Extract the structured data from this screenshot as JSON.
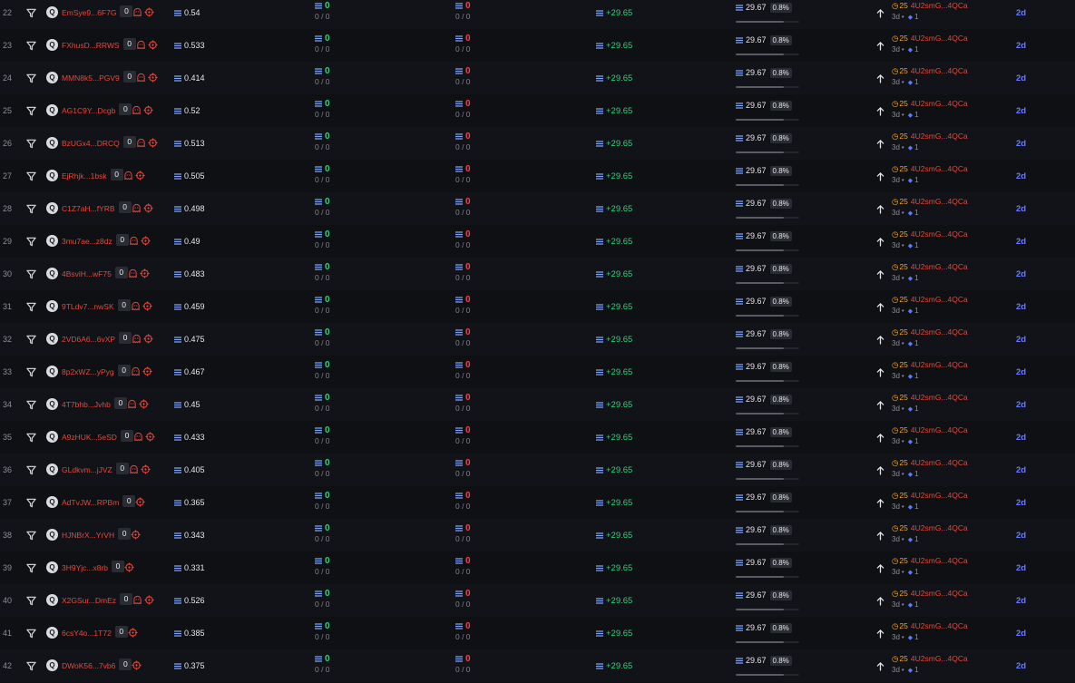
{
  "colors": {
    "background": "#0f1014",
    "address": "#e5483b",
    "positive": "#2bd67b",
    "negative": "#f0424d",
    "holder_count": "#f5a623",
    "age": "#6c7cff"
  },
  "icons": {
    "filter": "filter-icon",
    "avatar": "avatar-icon",
    "ghost": "ghost-icon",
    "target": "target-icon",
    "lines": "lines-icon",
    "arrow": "arrow-up-icon",
    "clock": "clock-icon"
  },
  "rows": [
    {
      "rank": "22",
      "avatar": "Q",
      "address": "EmSye9...6F7G",
      "badge": "0",
      "ghost": true,
      "score": "0.54",
      "buy": "0",
      "buy_sub": "0 / 0",
      "sell": "0",
      "sell_sub": "0 / 0",
      "pnl": "+29.65",
      "price": "29.67",
      "pct": "0.8%",
      "bar_fill": 0.75,
      "holder_count": "25",
      "holder_addr": "4U2smG...4QCa",
      "holder_age": "3d",
      "holder_num": "1",
      "age": "2d"
    },
    {
      "rank": "23",
      "avatar": "Q",
      "address": "FXhusD...RRWS",
      "badge": "0",
      "ghost": true,
      "score": "0.533",
      "buy": "0",
      "buy_sub": "0 / 0",
      "sell": "0",
      "sell_sub": "0 / 0",
      "pnl": "+29.65",
      "price": "29.67",
      "pct": "0.8%",
      "bar_fill": 0.75,
      "holder_count": "25",
      "holder_addr": "4U2smG...4QCa",
      "holder_age": "3d",
      "holder_num": "1",
      "age": "2d"
    },
    {
      "rank": "24",
      "avatar": "Q",
      "address": "MMN8k5...PGV9",
      "badge": "0",
      "ghost": true,
      "score": "0.414",
      "buy": "0",
      "buy_sub": "0 / 0",
      "sell": "0",
      "sell_sub": "0 / 0",
      "pnl": "+29.65",
      "price": "29.67",
      "pct": "0.8%",
      "bar_fill": 0.75,
      "holder_count": "25",
      "holder_addr": "4U2smG...4QCa",
      "holder_age": "3d",
      "holder_num": "1",
      "age": "2d"
    },
    {
      "rank": "25",
      "avatar": "Q",
      "address": "AG1C9Y...Dcgb",
      "badge": "0",
      "ghost": true,
      "score": "0.52",
      "buy": "0",
      "buy_sub": "0 / 0",
      "sell": "0",
      "sell_sub": "0 / 0",
      "pnl": "+29.65",
      "price": "29.67",
      "pct": "0.8%",
      "bar_fill": 0.75,
      "holder_count": "25",
      "holder_addr": "4U2smG...4QCa",
      "holder_age": "3d",
      "holder_num": "1",
      "age": "2d"
    },
    {
      "rank": "26",
      "avatar": "Q",
      "address": "BzUGx4...DRCQ",
      "badge": "0",
      "ghost": true,
      "score": "0.513",
      "buy": "0",
      "buy_sub": "0 / 0",
      "sell": "0",
      "sell_sub": "0 / 0",
      "pnl": "+29.65",
      "price": "29.67",
      "pct": "0.8%",
      "bar_fill": 0.75,
      "holder_count": "25",
      "holder_addr": "4U2smG...4QCa",
      "holder_age": "3d",
      "holder_num": "1",
      "age": "2d"
    },
    {
      "rank": "27",
      "avatar": "Q",
      "address": "EjRhjk...1bsk",
      "badge": "0",
      "ghost": true,
      "score": "0.505",
      "buy": "0",
      "buy_sub": "0 / 0",
      "sell": "0",
      "sell_sub": "0 / 0",
      "pnl": "+29.65",
      "price": "29.67",
      "pct": "0.8%",
      "bar_fill": 0.75,
      "holder_count": "25",
      "holder_addr": "4U2smG...4QCa",
      "holder_age": "3d",
      "holder_num": "1",
      "age": "2d"
    },
    {
      "rank": "28",
      "avatar": "Q",
      "address": "C1Z7aH...fYRB",
      "badge": "0",
      "ghost": true,
      "score": "0.498",
      "buy": "0",
      "buy_sub": "0 / 0",
      "sell": "0",
      "sell_sub": "0 / 0",
      "pnl": "+29.65",
      "price": "29.67",
      "pct": "0.8%",
      "bar_fill": 0.75,
      "holder_count": "25",
      "holder_addr": "4U2smG...4QCa",
      "holder_age": "3d",
      "holder_num": "1",
      "age": "2d"
    },
    {
      "rank": "29",
      "avatar": "Q",
      "address": "3mu7ae...z8dz",
      "badge": "0",
      "ghost": true,
      "score": "0.49",
      "buy": "0",
      "buy_sub": "0 / 0",
      "sell": "0",
      "sell_sub": "0 / 0",
      "pnl": "+29.65",
      "price": "29.67",
      "pct": "0.8%",
      "bar_fill": 0.75,
      "holder_count": "25",
      "holder_addr": "4U2smG...4QCa",
      "holder_age": "3d",
      "holder_num": "1",
      "age": "2d"
    },
    {
      "rank": "30",
      "avatar": "Q",
      "address": "4BsviH...wF75",
      "badge": "0",
      "ghost": true,
      "score": "0.483",
      "buy": "0",
      "buy_sub": "0 / 0",
      "sell": "0",
      "sell_sub": "0 / 0",
      "pnl": "+29.65",
      "price": "29.67",
      "pct": "0.8%",
      "bar_fill": 0.75,
      "holder_count": "25",
      "holder_addr": "4U2smG...4QCa",
      "holder_age": "3d",
      "holder_num": "1",
      "age": "2d"
    },
    {
      "rank": "31",
      "avatar": "Q",
      "address": "9TLdv7...nwSK",
      "badge": "0",
      "ghost": true,
      "score": "0.459",
      "buy": "0",
      "buy_sub": "0 / 0",
      "sell": "0",
      "sell_sub": "0 / 0",
      "pnl": "+29.65",
      "price": "29.67",
      "pct": "0.8%",
      "bar_fill": 0.75,
      "holder_count": "25",
      "holder_addr": "4U2smG...4QCa",
      "holder_age": "3d",
      "holder_num": "1",
      "age": "2d"
    },
    {
      "rank": "32",
      "avatar": "Q",
      "address": "2VD6A6...6vXP",
      "badge": "0",
      "ghost": true,
      "score": "0.475",
      "buy": "0",
      "buy_sub": "0 / 0",
      "sell": "0",
      "sell_sub": "0 / 0",
      "pnl": "+29.65",
      "price": "29.67",
      "pct": "0.8%",
      "bar_fill": 0.75,
      "holder_count": "25",
      "holder_addr": "4U2smG...4QCa",
      "holder_age": "3d",
      "holder_num": "1",
      "age": "2d"
    },
    {
      "rank": "33",
      "avatar": "Q",
      "address": "8p2xWZ...yPyg",
      "badge": "0",
      "ghost": true,
      "score": "0.467",
      "buy": "0",
      "buy_sub": "0 / 0",
      "sell": "0",
      "sell_sub": "0 / 0",
      "pnl": "+29.65",
      "price": "29.67",
      "pct": "0.8%",
      "bar_fill": 0.75,
      "holder_count": "25",
      "holder_addr": "4U2smG...4QCa",
      "holder_age": "3d",
      "holder_num": "1",
      "age": "2d"
    },
    {
      "rank": "34",
      "avatar": "Q",
      "address": "4T7bhb...Jvhb",
      "badge": "0",
      "ghost": true,
      "score": "0.45",
      "buy": "0",
      "buy_sub": "0 / 0",
      "sell": "0",
      "sell_sub": "0 / 0",
      "pnl": "+29.65",
      "price": "29.67",
      "pct": "0.8%",
      "bar_fill": 0.75,
      "holder_count": "25",
      "holder_addr": "4U2smG...4QCa",
      "holder_age": "3d",
      "holder_num": "1",
      "age": "2d"
    },
    {
      "rank": "35",
      "avatar": "Q",
      "address": "A9zHUK...5eSD",
      "badge": "0",
      "ghost": true,
      "score": "0.433",
      "buy": "0",
      "buy_sub": "0 / 0",
      "sell": "0",
      "sell_sub": "0 / 0",
      "pnl": "+29.65",
      "price": "29.67",
      "pct": "0.8%",
      "bar_fill": 0.75,
      "holder_count": "25",
      "holder_addr": "4U2smG...4QCa",
      "holder_age": "3d",
      "holder_num": "1",
      "age": "2d"
    },
    {
      "rank": "36",
      "avatar": "Q",
      "address": "GLdkvm...jJVZ",
      "badge": "0",
      "ghost": true,
      "score": "0.405",
      "buy": "0",
      "buy_sub": "0 / 0",
      "sell": "0",
      "sell_sub": "0 / 0",
      "pnl": "+29.65",
      "price": "29.67",
      "pct": "0.8%",
      "bar_fill": 0.75,
      "holder_count": "25",
      "holder_addr": "4U2smG...4QCa",
      "holder_age": "3d",
      "holder_num": "1",
      "age": "2d"
    },
    {
      "rank": "37",
      "avatar": "Q",
      "address": "AdTvJW...RPBm",
      "badge": "0",
      "ghost": false,
      "score": "0.365",
      "buy": "0",
      "buy_sub": "0 / 0",
      "sell": "0",
      "sell_sub": "0 / 0",
      "pnl": "+29.65",
      "price": "29.67",
      "pct": "0.8%",
      "bar_fill": 0.75,
      "holder_count": "25",
      "holder_addr": "4U2smG...4QCa",
      "holder_age": "3d",
      "holder_num": "1",
      "age": "2d"
    },
    {
      "rank": "38",
      "avatar": "Q",
      "address": "HJNBrX...YrVH",
      "badge": "0",
      "ghost": false,
      "score": "0.343",
      "buy": "0",
      "buy_sub": "0 / 0",
      "sell": "0",
      "sell_sub": "0 / 0",
      "pnl": "+29.65",
      "price": "29.67",
      "pct": "0.8%",
      "bar_fill": 0.75,
      "holder_count": "25",
      "holder_addr": "4U2smG...4QCa",
      "holder_age": "3d",
      "holder_num": "1",
      "age": "2d"
    },
    {
      "rank": "39",
      "avatar": "Q",
      "address": "3H9Yjc...x8rb",
      "badge": "0",
      "ghost": false,
      "score": "0.331",
      "buy": "0",
      "buy_sub": "0 / 0",
      "sell": "0",
      "sell_sub": "0 / 0",
      "pnl": "+29.65",
      "price": "29.67",
      "pct": "0.8%",
      "bar_fill": 0.75,
      "holder_count": "25",
      "holder_addr": "4U2smG...4QCa",
      "holder_age": "3d",
      "holder_num": "1",
      "age": "2d"
    },
    {
      "rank": "40",
      "avatar": "Q",
      "address": "X2GSur...DmEz",
      "badge": "0",
      "ghost": true,
      "score": "0.526",
      "buy": "0",
      "buy_sub": "0 / 0",
      "sell": "0",
      "sell_sub": "0 / 0",
      "pnl": "+29.65",
      "price": "29.67",
      "pct": "0.8%",
      "bar_fill": 0.75,
      "holder_count": "25",
      "holder_addr": "4U2smG...4QCa",
      "holder_age": "3d",
      "holder_num": "1",
      "age": "2d"
    },
    {
      "rank": "41",
      "avatar": "Q",
      "address": "6csY4o...1T72",
      "badge": "0",
      "ghost": false,
      "score": "0.385",
      "buy": "0",
      "buy_sub": "0 / 0",
      "sell": "0",
      "sell_sub": "0 / 0",
      "pnl": "+29.65",
      "price": "29.67",
      "pct": "0.8%",
      "bar_fill": 0.75,
      "holder_count": "25",
      "holder_addr": "4U2smG...4QCa",
      "holder_age": "3d",
      "holder_num": "1",
      "age": "2d"
    },
    {
      "rank": "42",
      "avatar": "Q",
      "address": "DWoK56...7vb6",
      "badge": "0",
      "ghost": false,
      "score": "0.375",
      "buy": "0",
      "buy_sub": "0 / 0",
      "sell": "0",
      "sell_sub": "0 / 0",
      "pnl": "+29.65",
      "price": "29.67",
      "pct": "0.8%",
      "bar_fill": 0.75,
      "holder_count": "25",
      "holder_addr": "4U2smG...4QCa",
      "holder_age": "3d",
      "holder_num": "1",
      "age": "2d"
    }
  ]
}
